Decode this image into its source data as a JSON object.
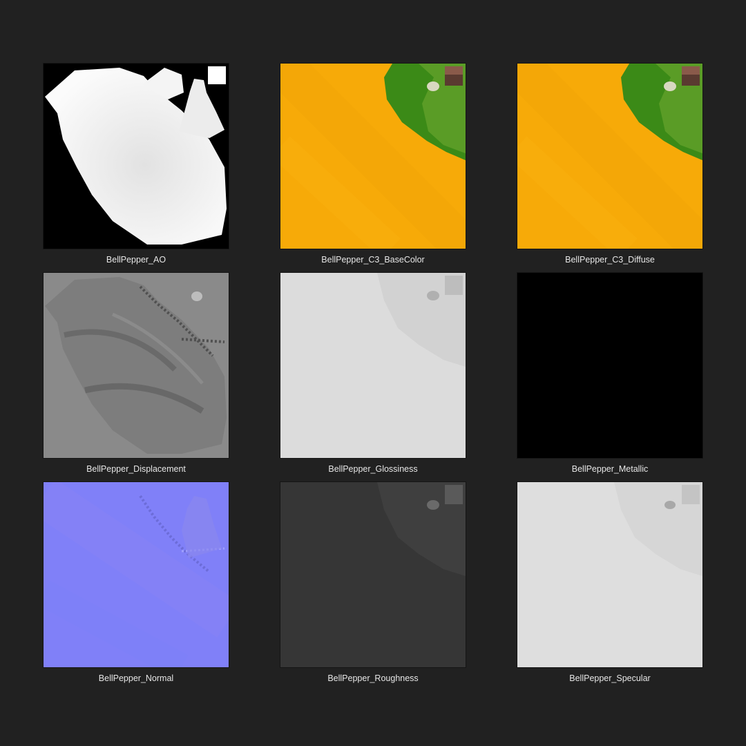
{
  "gallery": {
    "items": [
      {
        "label": "BellPepper_AO",
        "icon": "ambient-occlusion-map"
      },
      {
        "label": "BellPepper_C3_BaseColor",
        "icon": "base-color-map"
      },
      {
        "label": "BellPepper_C3_Diffuse",
        "icon": "diffuse-map"
      },
      {
        "label": "BellPepper_Displacement",
        "icon": "displacement-map"
      },
      {
        "label": "BellPepper_Glossiness",
        "icon": "glossiness-map"
      },
      {
        "label": "BellPepper_Metallic",
        "icon": "metallic-map"
      },
      {
        "label": "BellPepper_Normal",
        "icon": "normal-map"
      },
      {
        "label": "BellPepper_Roughness",
        "icon": "roughness-map"
      },
      {
        "label": "BellPepper_Specular",
        "icon": "specular-map"
      }
    ]
  },
  "colors": {
    "background": "#212121",
    "label_text": "#e6e6e6",
    "pepper_yellow": "#f7aa08",
    "stem_green": "#3f8a1a",
    "normal_blue": "#8080f8"
  }
}
